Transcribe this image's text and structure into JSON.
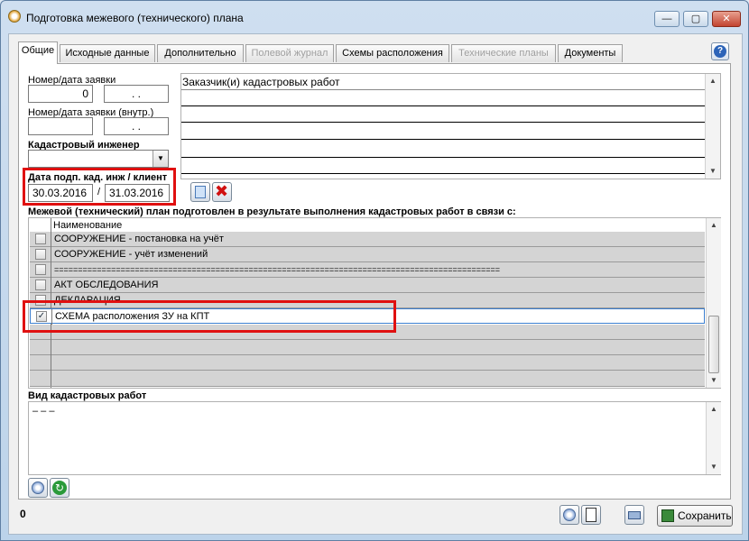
{
  "window": {
    "title": "Подготовка межевого (технического) плана",
    "minimize_glyph": "—",
    "maximize_glyph": "▢",
    "close_glyph": "✕"
  },
  "tabs": [
    {
      "label": "Общие",
      "active": true,
      "enabled": true
    },
    {
      "label": "Исходные данные",
      "active": false,
      "enabled": true
    },
    {
      "label": "Дополнительно",
      "active": false,
      "enabled": true
    },
    {
      "label": "Полевой журнал",
      "active": false,
      "enabled": false
    },
    {
      "label": "Схемы расположения",
      "active": false,
      "enabled": true
    },
    {
      "label": "Технические планы",
      "active": false,
      "enabled": false
    },
    {
      "label": "Документы",
      "active": false,
      "enabled": true
    }
  ],
  "help_glyph": "?",
  "form": {
    "request_label": "Номер/дата заявки",
    "request_number": "0",
    "request_date": " .  .",
    "request_internal_label": "Номер/дата заявки (внутр.)",
    "request_internal_number": "",
    "request_internal_date": " .  .",
    "engineer_label": "Кадастровый инженер",
    "engineer_value": "",
    "sign_date_label": "Дата подп. кад. инж / клиент",
    "sign_date_engineer": "30.03.2016",
    "sign_date_separator": "/",
    "sign_date_client": "31.03.2016",
    "customers_header": "Заказчик(и) кадастровых работ",
    "plan_reason_label": "Межевой (технический) план подготовлен в результате выполнения кадастровых работ в связи с:",
    "list_header": "Наименование",
    "work_type_label": "Вид кадастровых работ",
    "work_type_value": "– – –"
  },
  "reasons": [
    {
      "label": "СООРУЖЕНИЕ - постановка на учёт",
      "checked": false
    },
    {
      "label": "СООРУЖЕНИЕ - учёт изменений",
      "checked": false
    },
    {
      "label": "==============================================================================================",
      "checked": false
    },
    {
      "label": "АКТ ОБСЛЕДОВАНИЯ",
      "checked": false
    },
    {
      "label": "ДЕКЛАРАЦИЯ",
      "checked": false
    },
    {
      "label": "СХЕМА расположения ЗУ на КПТ",
      "checked": true
    }
  ],
  "status_count": "0",
  "save_label": "Сохранить",
  "colors": {
    "highlight": "#e01010",
    "selection": "#3c7fd0"
  }
}
